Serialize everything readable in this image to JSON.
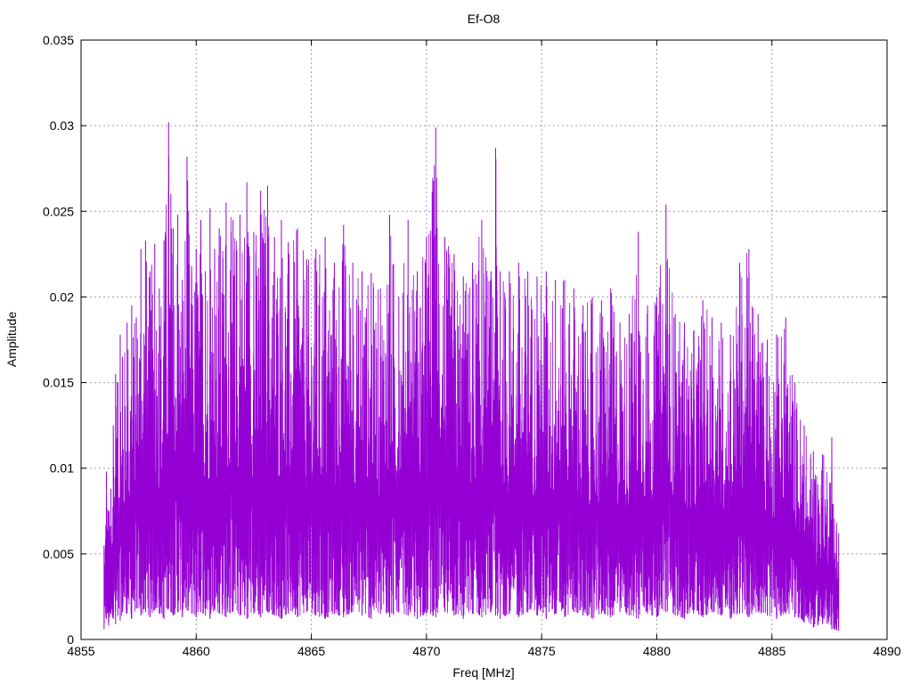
{
  "chart_data": {
    "type": "line",
    "title": "Ef-O8",
    "xlabel": "Freq [MHz]",
    "ylabel": "Amplitude",
    "xlim": [
      4855,
      4890
    ],
    "ylim": [
      0,
      0.035
    ],
    "grid": true,
    "x_ticks": [
      4855,
      4860,
      4865,
      4870,
      4875,
      4880,
      4885,
      4890
    ],
    "x_tick_labels": [
      "4855",
      "4860",
      "4865",
      "4870",
      "4875",
      "4880",
      "4885",
      "4890"
    ],
    "y_ticks": [
      0,
      0.005,
      0.01,
      0.015,
      0.02,
      0.025,
      0.03,
      0.035
    ],
    "y_tick_labels": [
      "0",
      "0.005",
      "0.01",
      "0.015",
      "0.02",
      "0.025",
      "0.03",
      "0.035"
    ],
    "series_color": "#9400D3",
    "series": [
      {
        "x": [
          4856.0,
          4856.1,
          4856.2,
          4856.3,
          4856.4,
          4856.5,
          4856.6,
          4856.7,
          4856.8,
          4857.0,
          4857.2,
          4857.4,
          4857.6,
          4857.8,
          4858.0,
          4858.2,
          4858.4,
          4858.6,
          4858.8,
          4858.9,
          4859.0,
          4859.2,
          4859.4,
          4859.6,
          4859.8,
          4860.0,
          4860.2,
          4860.4,
          4860.6,
          4860.8,
          4861.0,
          4861.3,
          4861.6,
          4861.9,
          4862.2,
          4862.5,
          4862.8,
          4863.1,
          4863.4,
          4863.7,
          4864.0,
          4864.4,
          4864.8,
          4865.2,
          4865.6,
          4866.0,
          4866.4,
          4866.8,
          4867.2,
          4867.6,
          4868.0,
          4868.4,
          4868.8,
          4869.2,
          4869.6,
          4870.0,
          4870.4,
          4870.8,
          4871.2,
          4871.6,
          4872.0,
          4872.4,
          4872.8,
          4873.0,
          4873.2,
          4873.6,
          4874.0,
          4874.4,
          4874.8,
          4875.2,
          4875.6,
          4876.0,
          4876.4,
          4876.8,
          4877.2,
          4877.6,
          4878.0,
          4878.4,
          4878.8,
          4879.2,
          4879.6,
          4880.0,
          4880.4,
          4880.8,
          4881.2,
          4881.6,
          4882.0,
          4882.4,
          4882.8,
          4883.2,
          4883.6,
          4884.0,
          4884.4,
          4884.8,
          4885.2,
          4885.6,
          4886.0,
          4886.4,
          4886.8,
          4887.2,
          4887.6,
          4887.9
        ],
        "lower": [
          0.0006,
          0.0012,
          0.0008,
          0.0015,
          0.0012,
          0.0009,
          0.0014,
          0.0011,
          0.0016,
          0.0015,
          0.0012,
          0.0018,
          0.0014,
          0.0016,
          0.0013,
          0.0017,
          0.0015,
          0.0012,
          0.0018,
          0.0016,
          0.0014,
          0.0016,
          0.0013,
          0.0017,
          0.0015,
          0.0013,
          0.0016,
          0.0014,
          0.0012,
          0.0017,
          0.0015,
          0.0013,
          0.0016,
          0.0014,
          0.0012,
          0.0015,
          0.0013,
          0.0016,
          0.0014,
          0.0012,
          0.0015,
          0.0013,
          0.0016,
          0.0014,
          0.0012,
          0.0015,
          0.0013,
          0.0016,
          0.0014,
          0.0012,
          0.0015,
          0.0013,
          0.0016,
          0.0014,
          0.0012,
          0.0015,
          0.0013,
          0.0016,
          0.0014,
          0.0012,
          0.0015,
          0.0013,
          0.0016,
          0.0014,
          0.0012,
          0.0015,
          0.0013,
          0.0016,
          0.0014,
          0.0012,
          0.0015,
          0.0013,
          0.0016,
          0.0014,
          0.0012,
          0.0015,
          0.0013,
          0.0016,
          0.0014,
          0.0012,
          0.0015,
          0.0013,
          0.0016,
          0.0014,
          0.0012,
          0.0015,
          0.0013,
          0.0016,
          0.0014,
          0.0012,
          0.0015,
          0.0013,
          0.0016,
          0.0014,
          0.0012,
          0.0015,
          0.0013,
          0.001,
          0.0007,
          0.0009,
          0.0006,
          0.0005
        ],
        "upper": [
          0.0055,
          0.0098,
          0.0075,
          0.0088,
          0.0125,
          0.0155,
          0.015,
          0.0178,
          0.0165,
          0.0185,
          0.0195,
          0.0188,
          0.0228,
          0.0233,
          0.0215,
          0.0231,
          0.0205,
          0.0233,
          0.0302,
          0.026,
          0.024,
          0.0248,
          0.021,
          0.0282,
          0.0218,
          0.0228,
          0.0245,
          0.0215,
          0.0252,
          0.0228,
          0.024,
          0.0255,
          0.0245,
          0.0248,
          0.0267,
          0.0238,
          0.0262,
          0.0265,
          0.0235,
          0.0245,
          0.0232,
          0.024,
          0.0222,
          0.0228,
          0.0235,
          0.022,
          0.0242,
          0.022,
          0.0215,
          0.0214,
          0.0205,
          0.0248,
          0.02,
          0.0245,
          0.0215,
          0.0235,
          0.0299,
          0.0235,
          0.0225,
          0.0212,
          0.022,
          0.0245,
          0.0215,
          0.0287,
          0.0215,
          0.0215,
          0.022,
          0.0215,
          0.0212,
          0.0215,
          0.021,
          0.021,
          0.0205,
          0.0195,
          0.02,
          0.0198,
          0.0205,
          0.0185,
          0.019,
          0.0238,
          0.0195,
          0.02,
          0.0254,
          0.019,
          0.0185,
          0.018,
          0.0198,
          0.0188,
          0.0185,
          0.0178,
          0.022,
          0.0228,
          0.019,
          0.0175,
          0.0178,
          0.0188,
          0.015,
          0.0125,
          0.011,
          0.0108,
          0.0118,
          0.0062
        ]
      }
    ]
  }
}
